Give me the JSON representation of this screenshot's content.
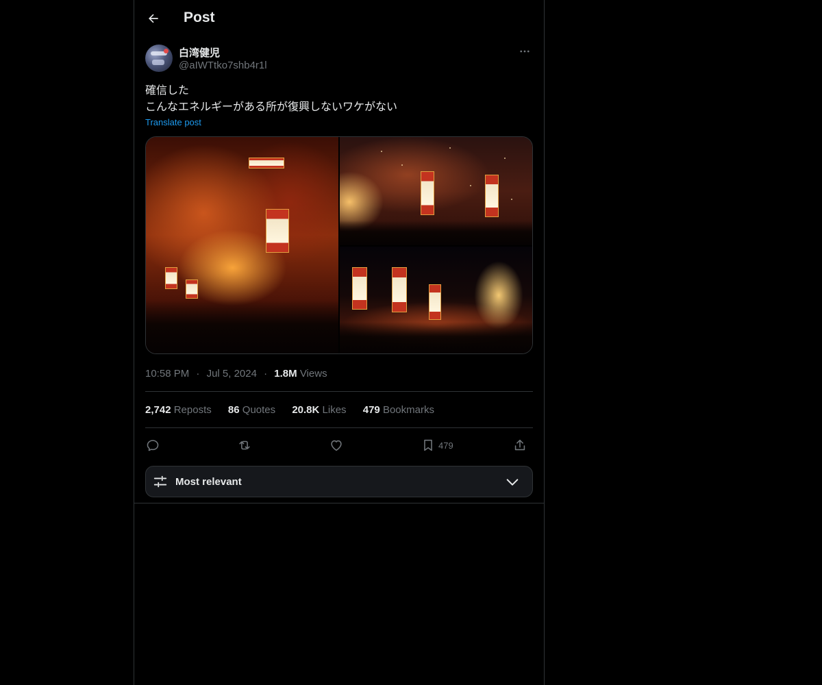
{
  "header": {
    "title": "Post"
  },
  "author": {
    "display_name": "白湾健児",
    "handle": "@aIWTtko7shb4r1l"
  },
  "post": {
    "lines": [
      "確信した",
      "こんなエネルギーがある所が復興しないワケがない"
    ],
    "translate_label": "Translate post"
  },
  "meta": {
    "time": "10:58 PM",
    "date": "Jul 5, 2024",
    "views_count": "1.8M",
    "views_label": "Views",
    "sep": "·"
  },
  "stats": {
    "reposts_count": "2,742",
    "reposts_label": "Reposts",
    "quotes_count": "86",
    "quotes_label": "Quotes",
    "likes_count": "20.8K",
    "likes_label": "Likes",
    "bookmarks_count": "479",
    "bookmarks_label": "Bookmarks"
  },
  "actions": {
    "bookmark_count": "479"
  },
  "sort": {
    "label": "Most relevant"
  },
  "icons": {
    "back": "arrow-left-icon",
    "more": "more-horizontal-icon",
    "reply": "reply-icon",
    "repost": "repost-icon",
    "like": "heart-icon",
    "bookmark": "bookmark-icon",
    "share": "share-icon",
    "sort": "sliders-icon",
    "chevron": "chevron-down-icon"
  },
  "colors": {
    "background": "#000000",
    "text": "#e7e9ea",
    "muted": "#71767b",
    "link": "#1d9bf0",
    "border": "#2f3336",
    "panel": "#16181c"
  }
}
